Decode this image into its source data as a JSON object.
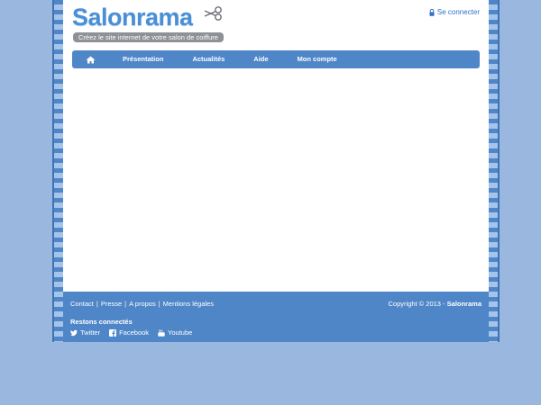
{
  "brand": {
    "logo_text": "Salonrama",
    "tagline": "Créez le site internet de votre salon de coiffure"
  },
  "header": {
    "login_label": "Se connecter"
  },
  "nav": {
    "home_icon": "home-icon",
    "items": [
      {
        "label": "Présentation"
      },
      {
        "label": "Actualités"
      },
      {
        "label": "Aide"
      },
      {
        "label": "Mon compte"
      }
    ]
  },
  "footer": {
    "links": [
      {
        "label": "Contact"
      },
      {
        "label": "Presse"
      },
      {
        "label": "A propos"
      },
      {
        "label": "Mentions légales"
      }
    ],
    "copyright_prefix": "Copyright © 2013 - ",
    "copyright_brand": "Salonrama",
    "social_title": "Restons connectés",
    "social": [
      {
        "label": "Twitter",
        "icon": "twitter-icon"
      },
      {
        "label": "Facebook",
        "icon": "facebook-icon"
      },
      {
        "label": "Youtube",
        "icon": "youtube-icon"
      }
    ]
  },
  "colors": {
    "background": "#9ab7df",
    "accent": "#4f86c8",
    "logo": "#4a8fd6",
    "link": "#2f6fc7"
  }
}
